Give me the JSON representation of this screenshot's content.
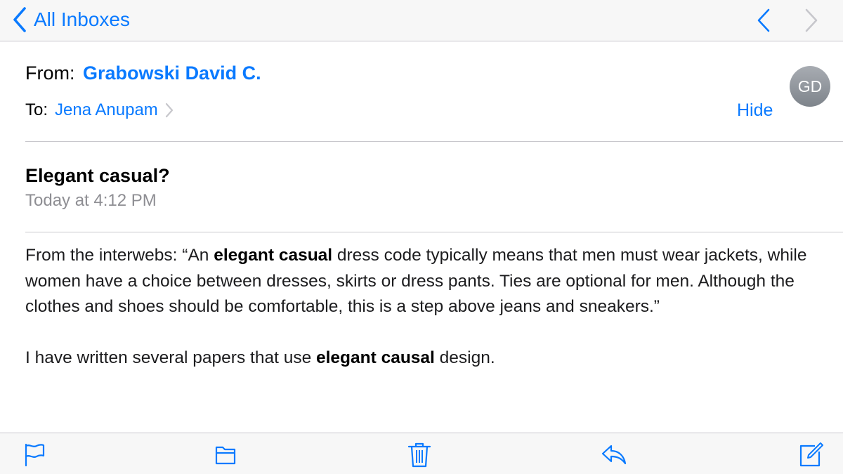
{
  "nav": {
    "back_label": "All Inboxes"
  },
  "header": {
    "from_label": "From:",
    "from_name": "Grabowski David C.",
    "to_label": "To:",
    "to_name": "Jena Anupam",
    "hide_label": "Hide",
    "avatar_initials": "GD"
  },
  "message": {
    "subject": "Elegant casual?",
    "timestamp": "Today at 4:12 PM",
    "paragraph_1": {
      "part_1": "From the interwebs: “An ",
      "bold_1": "elegant casual",
      "part_2": " dress code typically means that men must wear jackets, while women have a choice between dresses, skirts or dress pants. Ties are optional for men. Although the clothes and shoes should be comfortable, this is a step above jeans and sneakers.”"
    },
    "paragraph_2": {
      "part_1": "I have written several papers that use ",
      "bold_1": "elegant causal",
      "part_2": " design."
    }
  },
  "toolbar": {
    "icons": [
      "flag-icon",
      "folder-icon",
      "trash-icon",
      "reply-icon",
      "compose-icon"
    ]
  },
  "colors": {
    "accent": "#0a7aff",
    "secondary_text": "#8e8e93",
    "separator": "#c8c7cc",
    "bar_background": "#f7f7f7",
    "avatar": "#8e949b"
  }
}
